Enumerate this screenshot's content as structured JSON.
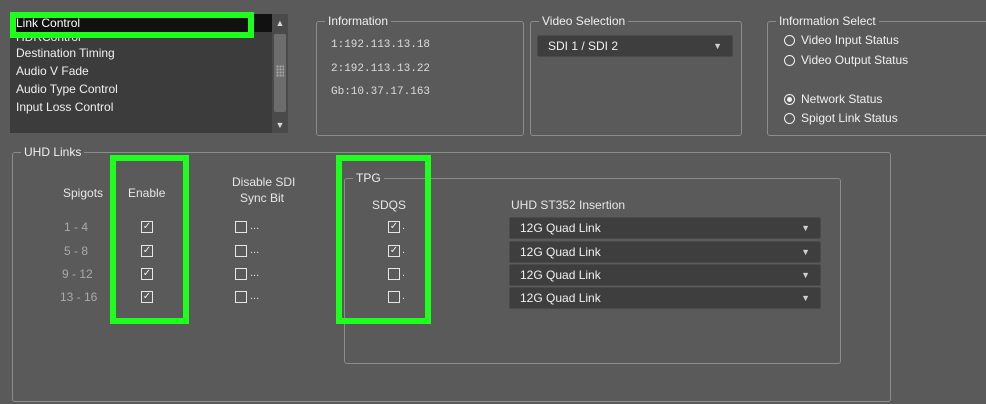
{
  "function_list": {
    "items": [
      {
        "label": "Link Control",
        "selected": true
      },
      {
        "label": "HDRControl",
        "selected": false
      },
      {
        "label": "Destination Timing",
        "selected": false
      },
      {
        "label": "Audio V Fade",
        "selected": false
      },
      {
        "label": "Audio Type Control",
        "selected": false
      },
      {
        "label": "Input Loss Control",
        "selected": false
      }
    ]
  },
  "information": {
    "title": "Information",
    "lines": [
      "1:192.113.13.18",
      "2:192.113.13.22",
      "Gb:10.37.17.163"
    ]
  },
  "video_selection": {
    "title": "Video Selection",
    "value": "SDI 1 / SDI 2"
  },
  "information_select": {
    "title": "Information Select",
    "options": [
      {
        "label": "Video Input Status",
        "checked": false
      },
      {
        "label": "Video Output Status",
        "checked": false
      },
      {
        "label": "Network Status",
        "checked": true
      },
      {
        "label": "Spigot Link Status",
        "checked": false
      }
    ]
  },
  "uhd_links": {
    "title": "UHD Links",
    "headers": {
      "spigots": "Spigots",
      "enable": "Enable",
      "disable_sdi_1": "Disable SDI",
      "disable_sdi_2": "Sync Bit",
      "tpg": "TPG",
      "sdqs": "SDQS",
      "insertion": "UHD ST352 Insertion"
    },
    "rows": [
      {
        "spigots": "1 - 4",
        "enable": true,
        "disable_sync": false,
        "sdqs": true,
        "insertion": "12G Quad Link"
      },
      {
        "spigots": "5 - 8",
        "enable": true,
        "disable_sync": false,
        "sdqs": true,
        "insertion": "12G Quad Link"
      },
      {
        "spigots": "9 - 12",
        "enable": true,
        "disable_sync": false,
        "sdqs": false,
        "insertion": "12G Quad Link"
      },
      {
        "spigots": "13 - 16",
        "enable": true,
        "disable_sync": false,
        "sdqs": false,
        "insertion": "12G Quad Link"
      }
    ]
  },
  "colors": {
    "highlight": "#1eff1e",
    "background": "#5a5a5a",
    "field": "#3e3e3e"
  }
}
